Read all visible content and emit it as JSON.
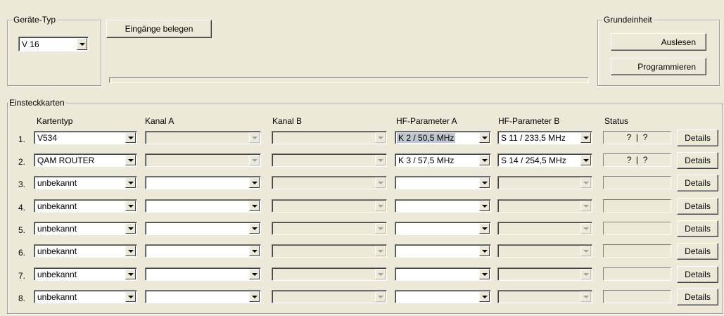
{
  "device_type": {
    "legend": "Geräte-Typ",
    "value": "V 16"
  },
  "assign_button": "Eingänge belegen",
  "base_unit": {
    "legend": "Grundeinheit",
    "read_button": "Auslesen",
    "program_button": "Programmieren"
  },
  "cards": {
    "legend": "Einsteckkarten",
    "headers": {
      "type": "Kartentyp",
      "channel_a": "Kanal A",
      "channel_b": "Kanal B",
      "hf_a": "HF-Parameter A",
      "hf_b": "HF-Parameter B",
      "status": "Status"
    },
    "details_label": "Details",
    "rows": [
      {
        "num": "1.",
        "type": "V534",
        "channel_a": "",
        "channel_b": "",
        "hf_a": "K 2 / 50,5 MHz",
        "hf_b": "S 11 / 233,5 MHz",
        "status": "?  |  ?"
      },
      {
        "num": "2.",
        "type": "QAM ROUTER",
        "channel_a": "",
        "channel_b": "",
        "hf_a": "K 3 / 57,5 MHz",
        "hf_b": "S 14 / 254,5 MHz",
        "status": "?  |  ?"
      },
      {
        "num": "3.",
        "type": "unbekannt",
        "channel_a": "",
        "channel_b": "",
        "hf_a": "",
        "hf_b": "",
        "status": ""
      },
      {
        "num": "4.",
        "type": "unbekannt",
        "channel_a": "",
        "channel_b": "",
        "hf_a": "",
        "hf_b": "",
        "status": ""
      },
      {
        "num": "5.",
        "type": "unbekannt",
        "channel_a": "",
        "channel_b": "",
        "hf_a": "",
        "hf_b": "",
        "status": ""
      },
      {
        "num": "6.",
        "type": "unbekannt",
        "channel_a": "",
        "channel_b": "",
        "hf_a": "",
        "hf_b": "",
        "status": ""
      },
      {
        "num": "7.",
        "type": "unbekannt",
        "channel_a": "",
        "channel_b": "",
        "hf_a": "",
        "hf_b": "",
        "status": ""
      },
      {
        "num": "8.",
        "type": "unbekannt",
        "channel_a": "",
        "channel_b": "",
        "hf_a": "",
        "hf_b": "",
        "status": ""
      }
    ]
  }
}
